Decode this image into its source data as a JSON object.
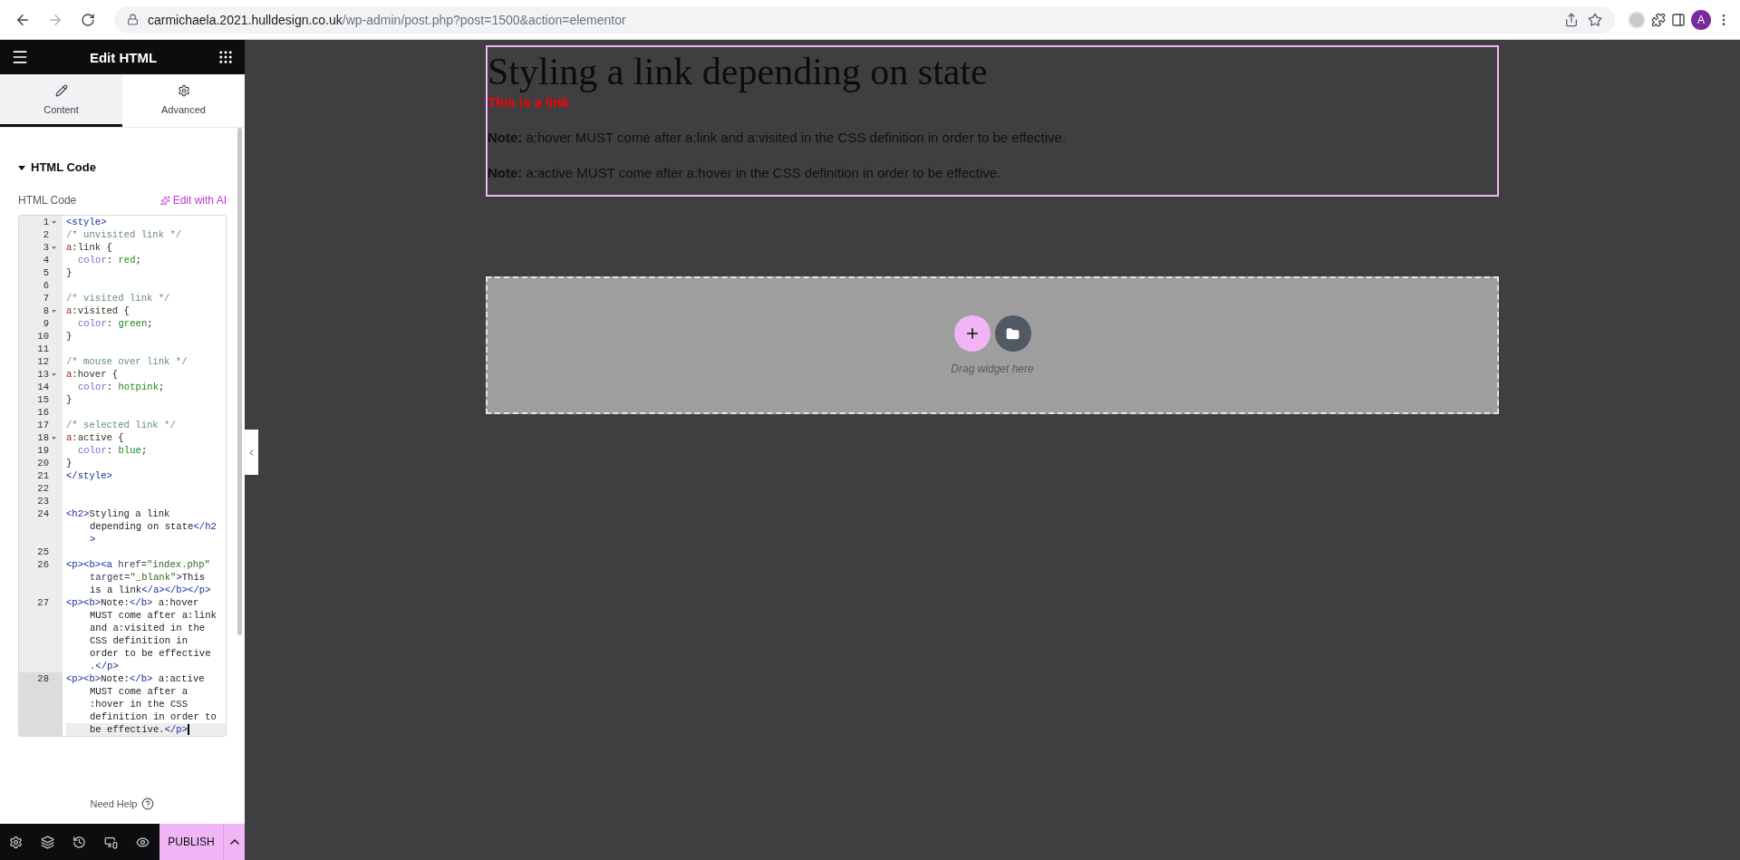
{
  "browser": {
    "address": {
      "host": "carmichaela.2021.hulldesign.co.uk",
      "path": "/wp-admin/post.php?post=1500&action=elementor"
    },
    "forward_disabled": true,
    "profile_initial": "A"
  },
  "panel": {
    "title": "Edit HTML",
    "tabs": [
      {
        "label": "Content",
        "selected": true
      },
      {
        "label": "Advanced",
        "selected": false
      }
    ],
    "section": {
      "title": "HTML Code",
      "expanded": true
    },
    "field_label": "HTML Code",
    "ai_button": "Edit with AI",
    "code_lines": [
      {
        "number": "1",
        "foldable": true,
        "active": false,
        "rows": [
          {
            "tokens": [
              {
                "kind": "tag",
                "text": "<style>"
              }
            ]
          }
        ]
      },
      {
        "number": "2",
        "foldable": false,
        "active": false,
        "rows": [
          {
            "tokens": [
              {
                "kind": "comment",
                "text": "/* unvisited link */"
              }
            ]
          }
        ]
      },
      {
        "number": "3",
        "foldable": true,
        "active": false,
        "rows": [
          {
            "tokens": [
              {
                "kind": "selector",
                "text": "a"
              },
              {
                "kind": "pseudo",
                "text": ":link"
              },
              {
                "kind": "plain",
                "text": " {"
              }
            ]
          }
        ]
      },
      {
        "number": "4",
        "foldable": false,
        "active": false,
        "rows": [
          {
            "indented": true,
            "tokens": [
              {
                "kind": "property",
                "text": "color"
              },
              {
                "kind": "plain",
                "text": ": "
              },
              {
                "kind": "value",
                "text": "red"
              },
              {
                "kind": "plain",
                "text": ";"
              }
            ]
          }
        ]
      },
      {
        "number": "5",
        "foldable": false,
        "active": false,
        "rows": [
          {
            "tokens": [
              {
                "kind": "plain",
                "text": "}"
              }
            ]
          }
        ]
      },
      {
        "number": "6",
        "foldable": false,
        "active": false
      },
      {
        "number": "7",
        "foldable": false,
        "active": false,
        "rows": [
          {
            "tokens": [
              {
                "kind": "comment",
                "text": "/* visited link */"
              }
            ]
          }
        ]
      },
      {
        "number": "8",
        "foldable": true,
        "active": false,
        "rows": [
          {
            "tokens": [
              {
                "kind": "selector",
                "text": "a"
              },
              {
                "kind": "pseudo",
                "text": ":visited"
              },
              {
                "kind": "plain",
                "text": " {"
              }
            ]
          }
        ]
      },
      {
        "number": "9",
        "foldable": false,
        "active": false,
        "rows": [
          {
            "indented": true,
            "tokens": [
              {
                "kind": "property",
                "text": "color"
              },
              {
                "kind": "plain",
                "text": ": "
              },
              {
                "kind": "value",
                "text": "green"
              },
              {
                "kind": "plain",
                "text": ";"
              }
            ]
          }
        ]
      },
      {
        "number": "10",
        "foldable": false,
        "active": false,
        "rows": [
          {
            "tokens": [
              {
                "kind": "plain",
                "text": "}"
              }
            ]
          }
        ]
      },
      {
        "number": "11",
        "foldable": false,
        "active": false
      },
      {
        "number": "12",
        "foldable": false,
        "active": false,
        "rows": [
          {
            "tokens": [
              {
                "kind": "comment",
                "text": "/* mouse over link */"
              }
            ]
          }
        ]
      },
      {
        "number": "13",
        "foldable": true,
        "active": false,
        "rows": [
          {
            "tokens": [
              {
                "kind": "selector",
                "text": "a"
              },
              {
                "kind": "pseudo",
                "text": ":hover"
              },
              {
                "kind": "plain",
                "text": " {"
              }
            ]
          }
        ]
      },
      {
        "number": "14",
        "foldable": false,
        "active": false,
        "rows": [
          {
            "indented": true,
            "tokens": [
              {
                "kind": "property",
                "text": "color"
              },
              {
                "kind": "plain",
                "text": ": "
              },
              {
                "kind": "value",
                "text": "hotpink"
              },
              {
                "kind": "plain",
                "text": ";"
              }
            ]
          }
        ]
      },
      {
        "number": "15",
        "foldable": false,
        "active": false,
        "rows": [
          {
            "tokens": [
              {
                "kind": "plain",
                "text": "}"
              }
            ]
          }
        ]
      },
      {
        "number": "16",
        "foldable": false,
        "active": false
      },
      {
        "number": "17",
        "foldable": false,
        "active": false,
        "rows": [
          {
            "tokens": [
              {
                "kind": "comment",
                "text": "/* selected link */"
              }
            ]
          }
        ]
      },
      {
        "number": "18",
        "foldable": true,
        "active": false,
        "rows": [
          {
            "tokens": [
              {
                "kind": "selector",
                "text": "a"
              },
              {
                "kind": "pseudo",
                "text": ":active"
              },
              {
                "kind": "plain",
                "text": " {"
              }
            ]
          }
        ]
      },
      {
        "number": "19",
        "foldable": false,
        "active": false,
        "rows": [
          {
            "indented": true,
            "tokens": [
              {
                "kind": "property",
                "text": "color"
              },
              {
                "kind": "plain",
                "text": ": "
              },
              {
                "kind": "value",
                "text": "blue"
              },
              {
                "kind": "plain",
                "text": ";"
              }
            ]
          }
        ]
      },
      {
        "number": "20",
        "foldable": false,
        "active": false,
        "rows": [
          {
            "tokens": [
              {
                "kind": "plain",
                "text": "}"
              }
            ]
          }
        ]
      },
      {
        "number": "21",
        "foldable": false,
        "active": false,
        "rows": [
          {
            "tokens": [
              {
                "kind": "tag",
                "text": "</style>"
              }
            ]
          }
        ]
      },
      {
        "number": "22",
        "foldable": false,
        "active": false
      },
      {
        "number": "23",
        "foldable": false,
        "active": false
      },
      {
        "number": "24",
        "foldable": false,
        "active": false,
        "rows": [
          {
            "tokens": [
              {
                "kind": "tag",
                "text": "<h2>"
              },
              {
                "kind": "plain",
                "text": "Styling a link"
              }
            ]
          },
          {
            "tokens": [
              {
                "kind": "plain",
                "text": "depending on state"
              },
              {
                "kind": "tag",
                "text": "</h2"
              }
            ]
          },
          {
            "tokens": [
              {
                "kind": "tag",
                "text": ">"
              }
            ]
          }
        ]
      },
      {
        "number": "25",
        "foldable": false,
        "active": false
      },
      {
        "number": "26",
        "foldable": false,
        "active": false,
        "rows": [
          {
            "tokens": [
              {
                "kind": "tag",
                "text": "<p><b><a "
              },
              {
                "kind": "attribute",
                "text": "href="
              },
              {
                "kind": "string",
                "text": "\"index.php\""
              }
            ]
          },
          {
            "tokens": [
              {
                "kind": "attribute",
                "text": "target="
              },
              {
                "kind": "string",
                "text": "\"_blank\""
              },
              {
                "kind": "tag",
                "text": ">"
              },
              {
                "kind": "plain",
                "text": "This"
              }
            ]
          },
          {
            "tokens": [
              {
                "kind": "plain",
                "text": "is a link"
              },
              {
                "kind": "tag",
                "text": "</a></b></p>"
              }
            ]
          }
        ]
      },
      {
        "number": "27",
        "foldable": false,
        "active": false,
        "rows": [
          {
            "tokens": [
              {
                "kind": "tag",
                "text": "<p><b>"
              },
              {
                "kind": "plain",
                "text": "Note:"
              },
              {
                "kind": "tag",
                "text": "</b>"
              },
              {
                "kind": "plain",
                "text": " a:hover"
              }
            ]
          },
          {
            "tokens": [
              {
                "kind": "plain",
                "text": "MUST come after a:link"
              }
            ]
          },
          {
            "tokens": [
              {
                "kind": "plain",
                "text": "and a:visited in the"
              }
            ]
          },
          {
            "tokens": [
              {
                "kind": "plain",
                "text": "CSS definition in"
              }
            ]
          },
          {
            "tokens": [
              {
                "kind": "plain",
                "text": "order to be effective"
              }
            ]
          },
          {
            "tokens": [
              {
                "kind": "plain",
                "text": "."
              },
              {
                "kind": "tag",
                "text": "</p>"
              }
            ]
          }
        ]
      },
      {
        "number": "28",
        "foldable": false,
        "active": true,
        "rows": [
          {
            "tokens": [
              {
                "kind": "tag",
                "text": "<p><b>"
              },
              {
                "kind": "plain",
                "text": "Note:"
              },
              {
                "kind": "tag",
                "text": "</b>"
              },
              {
                "kind": "plain",
                "text": " a:active"
              }
            ]
          },
          {
            "tokens": [
              {
                "kind": "plain",
                "text": "MUST come after a"
              }
            ]
          },
          {
            "tokens": [
              {
                "kind": "plain",
                "text": ":hover in the CSS"
              }
            ]
          },
          {
            "tokens": [
              {
                "kind": "plain",
                "text": "definition in order to"
              }
            ]
          },
          {
            "tokens": [
              {
                "kind": "plain",
                "text": "be effective."
              },
              {
                "kind": "tag",
                "text": "</p>"
              }
            ]
          }
        ]
      }
    ],
    "help": "Need Help",
    "publish": "PUBLISH"
  },
  "canvas": {
    "heading": "Styling a link depending on state",
    "link": "This is a link",
    "notes": [
      "**Note:** a:hover MUST come after a:link and a:visited in the CSS definition in order to be effective.",
      "**Note:** a:active MUST come after a:hover in the CSS definition in order to be effective."
    ],
    "dropzone": "Drag widget here"
  }
}
